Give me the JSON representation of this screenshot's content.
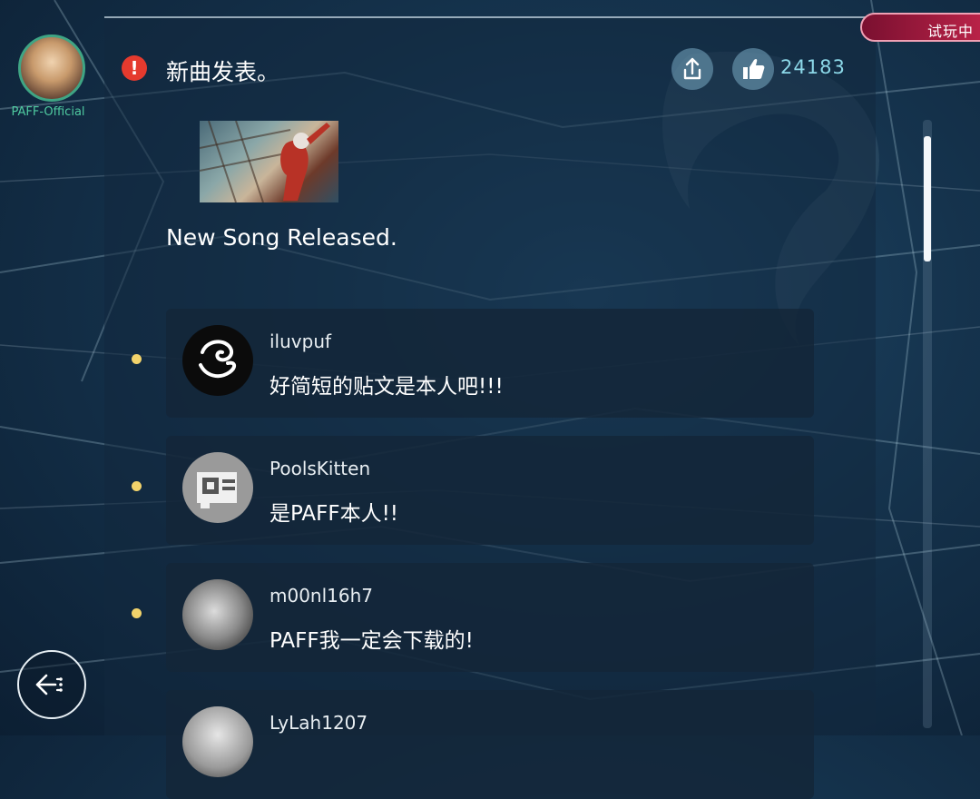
{
  "status": {
    "trial_label": "试玩中"
  },
  "post": {
    "author_name": "PAFF-Official",
    "title": "新曲发表。",
    "body": "New Song Released.",
    "like_count": "24183"
  },
  "icons": {
    "alert": "alert-icon",
    "share": "share-icon",
    "like": "thumbs-up-icon",
    "back": "back-arrow-icon"
  },
  "comments": [
    {
      "username": "iluvpuf",
      "text": "好简短的贴文是本人吧!!!"
    },
    {
      "username": "PoolsKitten",
      "text": "是PAFF本人!!"
    },
    {
      "username": "m00nl16h7",
      "text": "PAFF我一定会下载的!"
    },
    {
      "username": "LyLah1207",
      "text": ""
    }
  ],
  "colors": {
    "accent": "#8cd8e8",
    "author_name": "#4fcaa0",
    "alert": "#e53a2e",
    "dot": "#f2d36b",
    "trial_badge": "#c0244a"
  }
}
